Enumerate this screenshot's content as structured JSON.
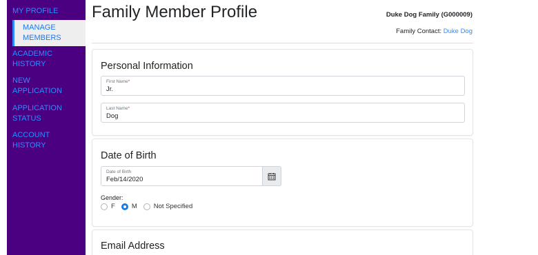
{
  "sidebar": {
    "items": [
      {
        "label": "MY PROFILE"
      },
      {
        "label": "MANAGE MEMBERS"
      },
      {
        "label": "ACADEMIC HISTORY"
      },
      {
        "label": "NEW APPLICATION"
      },
      {
        "label": "APPLICATION STATUS"
      },
      {
        "label": "ACCOUNT HISTORY"
      }
    ],
    "active_index": 1
  },
  "header": {
    "title": "Family Member Profile",
    "family_name": "Duke Dog Family (G000009)",
    "contact_label": "Family Contact:",
    "contact_name": "Duke Dog"
  },
  "personal": {
    "title": "Personal Information",
    "first_name": {
      "label": "First Name",
      "required_mark": "*",
      "value": "Jr."
    },
    "last_name": {
      "label": "Last Name",
      "required_mark": "*",
      "value": "Dog"
    }
  },
  "dob": {
    "title": "Date of Birth",
    "date": {
      "label": "Date of Birth",
      "value": "Feb/14/2020",
      "icon": "calendar-icon"
    },
    "gender_label": "Gender:",
    "gender_options": [
      {
        "label": "F",
        "checked": false
      },
      {
        "label": "M",
        "checked": true
      },
      {
        "label": "Not Specified",
        "checked": false
      }
    ]
  },
  "email": {
    "title": "Email Address"
  },
  "colors": {
    "sidebar_bg": "#4b0082",
    "link": "#2f8cff",
    "required": "#e03131"
  }
}
